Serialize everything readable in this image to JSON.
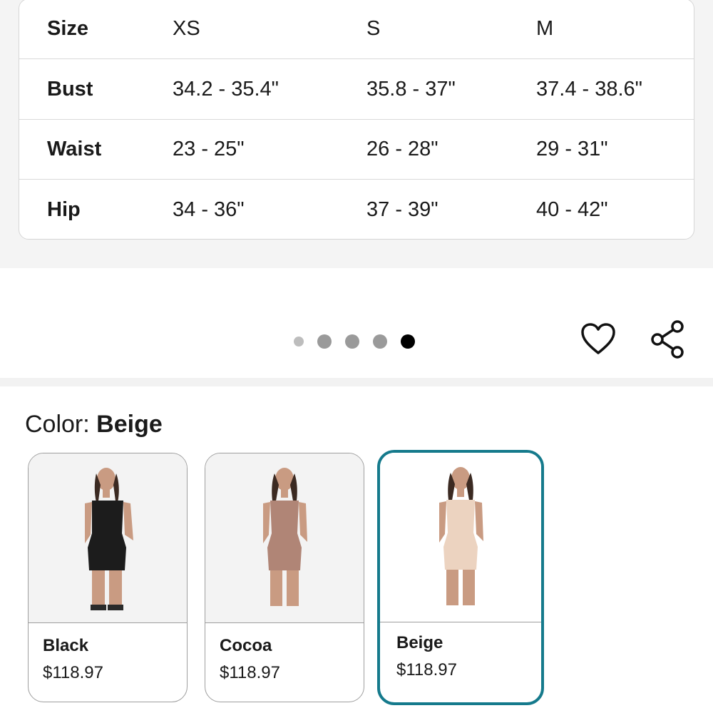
{
  "size_chart": {
    "rows": [
      {
        "label": "Size",
        "xs": "XS",
        "s": "S",
        "m": "M"
      },
      {
        "label": "Bust",
        "xs": "34.2 - 35.4\"",
        "s": "35.8 - 37\"",
        "m": "37.4 - 38.6\""
      },
      {
        "label": "Waist",
        "xs": "23 - 25\"",
        "s": "26 - 28\"",
        "m": "29 - 31\""
      },
      {
        "label": "Hip",
        "xs": "34 - 36\"",
        "s": "37 - 39\"",
        "m": "40 - 42\""
      }
    ]
  },
  "carousel": {
    "total_slides": 5,
    "active_slide": 5
  },
  "actions": {
    "favorite_icon": "heart-icon",
    "share_icon": "share-icon"
  },
  "color": {
    "label": "Color:",
    "selected": "Beige",
    "accent_color": "#157a8c",
    "options": [
      {
        "name": "Black",
        "price": "$118.97",
        "garment_color": "#1c1c1c"
      },
      {
        "name": "Cocoa",
        "price": "$118.97",
        "garment_color": "#b08576"
      },
      {
        "name": "Beige",
        "price": "$118.97",
        "garment_color": "#ecd3c0"
      }
    ]
  }
}
